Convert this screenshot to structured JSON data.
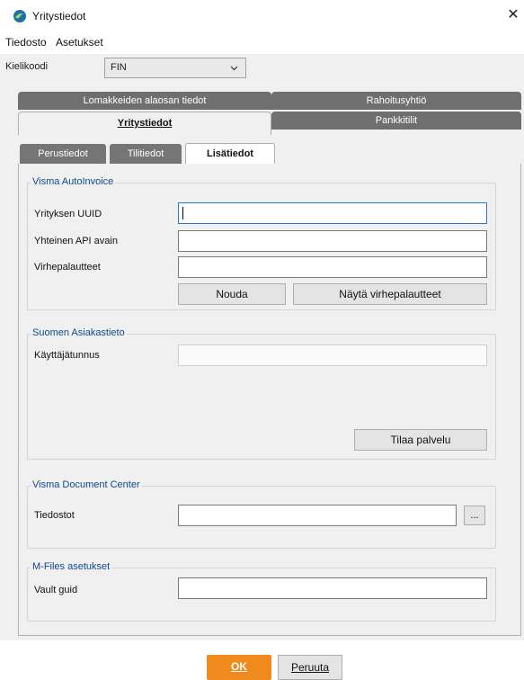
{
  "window": {
    "title": "Yritystiedot",
    "close_glyph": "✕"
  },
  "menu": [
    "Tiedosto",
    "Asetukset"
  ],
  "language": {
    "label": "Kielikoodi",
    "value": "FIN"
  },
  "top_tabs": {
    "row1": [
      "Lomakkeiden alaosan tiedot",
      "Rahoitusyhtiö"
    ],
    "row2": [
      "Yritystiedot",
      "Pankkitilit"
    ]
  },
  "sub_tabs": [
    "Perustiedot",
    "Tilitiedot",
    "Lisätiedot"
  ],
  "autoinvoice": {
    "legend": "Visma AutoInvoice",
    "fields": [
      {
        "label": "Yrityksen UUID",
        "value": ""
      },
      {
        "label": "Yhteinen API avain",
        "value": ""
      },
      {
        "label": "Virhepalautteet",
        "value": ""
      }
    ],
    "fetch_button": "Nouda",
    "show_errors_button": "Näytä virhepalautteet"
  },
  "asiakastieto": {
    "legend": "Suomen Asiakastieto",
    "username_label": "Käyttäjätunnus",
    "username_value": "",
    "order_button": "Tilaa palvelu"
  },
  "document_center": {
    "legend": "Visma Document Center",
    "files_label": "Tiedostot",
    "files_value": "",
    "browse_button": "..."
  },
  "mfiles": {
    "legend": "M-Files asetukset",
    "vault_label": "Vault guid",
    "vault_value": ""
  },
  "footer": {
    "ok": "OK",
    "cancel": "Peruuta"
  },
  "colors": {
    "accent": "#f08a1c",
    "tab_dark": "#6f6f6f",
    "legend_blue": "#0b4a8c"
  }
}
